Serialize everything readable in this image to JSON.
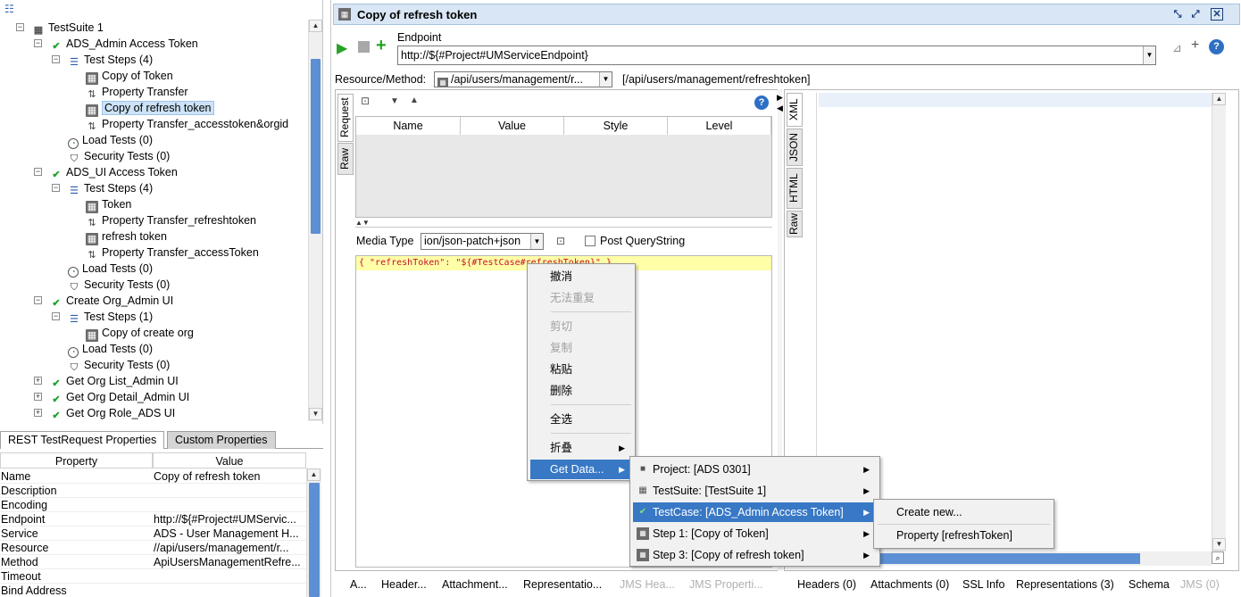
{
  "tree": {
    "rows": [
      {
        "label": "TestSuite 1"
      },
      {
        "label": "ADS_Admin Access Token"
      },
      {
        "label": "Test Steps (4)"
      },
      {
        "label": "Copy of Token"
      },
      {
        "label": "Property Transfer"
      },
      {
        "label": "Copy of refresh token"
      },
      {
        "label": "Property Transfer_accesstoken&orgid"
      },
      {
        "label": "Load Tests (0)"
      },
      {
        "label": "Security Tests (0)"
      },
      {
        "label": "ADS_UI Access Token"
      },
      {
        "label": "Test Steps (4)"
      },
      {
        "label": "Token"
      },
      {
        "label": "Property Transfer_refreshtoken"
      },
      {
        "label": "refresh token"
      },
      {
        "label": "Property Transfer_accessToken"
      },
      {
        "label": "Load Tests (0)"
      },
      {
        "label": "Security Tests (0)"
      },
      {
        "label": "Create Org_Admin UI"
      },
      {
        "label": "Test Steps (1)"
      },
      {
        "label": "Copy of create org"
      },
      {
        "label": "Load Tests (0)"
      },
      {
        "label": "Security Tests (0)"
      },
      {
        "label": "Get Org List_Admin UI"
      },
      {
        "label": "Get Org Detail_Admin UI"
      },
      {
        "label": "Get Org Role_ADS UI"
      }
    ]
  },
  "props": {
    "tabs": [
      "REST TestRequest Properties",
      "Custom Properties"
    ],
    "headers": {
      "property": "Property",
      "value": "Value"
    },
    "rows": [
      {
        "k": "Name",
        "v": "Copy of refresh token"
      },
      {
        "k": "Description",
        "v": ""
      },
      {
        "k": "Encoding",
        "v": ""
      },
      {
        "k": "Endpoint",
        "v": "http://${#Project#UMServic..."
      },
      {
        "k": "Service",
        "v": "ADS - User Management H..."
      },
      {
        "k": "Resource",
        "v": "//api/users/management/r..."
      },
      {
        "k": "Method",
        "v": "ApiUsersManagementRefre..."
      },
      {
        "k": "Timeout",
        "v": ""
      },
      {
        "k": "Bind Address",
        "v": ""
      }
    ]
  },
  "editor": {
    "title": "Copy of refresh token",
    "endpoint_label": "Endpoint",
    "endpoint_value": "http://${#Project#UMServiceEndpoint}",
    "resource_label": "Resource/Method:",
    "resource_value": "/api/users/management/r...",
    "resource_full": "[/api/users/management/refreshtoken]",
    "request_tab": "Request",
    "raw_tab": "Raw",
    "param_columns": [
      "Name",
      "Value",
      "Style",
      "Level"
    ],
    "media_type_label": "Media Type",
    "media_type_value": "ion/json-patch+json",
    "post_querystring": "Post QueryString",
    "body_text": "{   \"refreshToken\": \"${#TestCase#refreshToken}\" }",
    "response_tabs": [
      "XML",
      "JSON",
      "HTML",
      "Raw"
    ],
    "bottom_tabs_left": [
      {
        "label": "A...",
        "disabled": false
      },
      {
        "label": "Header...",
        "disabled": false
      },
      {
        "label": "Attachment...",
        "disabled": false
      },
      {
        "label": "Representatio...",
        "disabled": false
      },
      {
        "label": "JMS Hea...",
        "disabled": true
      },
      {
        "label": "JMS Properti...",
        "disabled": true
      }
    ],
    "bottom_tabs_right": [
      {
        "label": "Headers (0)",
        "disabled": false
      },
      {
        "label": "Attachments (0)",
        "disabled": false
      },
      {
        "label": "SSL Info",
        "disabled": false
      },
      {
        "label": "Representations (3)",
        "disabled": false
      },
      {
        "label": "Schema",
        "disabled": false
      },
      {
        "label": "JMS (0)",
        "disabled": true
      }
    ]
  },
  "context_menu": {
    "items": [
      "撤消",
      "无法重复",
      "剪切",
      "复制",
      "粘贴",
      "删除",
      "全选",
      "折叠",
      "Get Data..."
    ]
  },
  "submenu_getdata": {
    "items": [
      {
        "label": "Project: [ADS 0301]",
        "icon": "folder-icon"
      },
      {
        "label": "TestSuite: [TestSuite 1]",
        "icon": "grid-icon"
      },
      {
        "label": "TestCase: [ADS_Admin Access Token]",
        "icon": "check-icon"
      },
      {
        "label": "Step 1: [Copy of Token]",
        "icon": "step-icon"
      },
      {
        "label": "Step 3: [Copy of refresh token]",
        "icon": "step-icon"
      }
    ]
  },
  "submenu_testcase": {
    "items": [
      "Create new...",
      "Property [refreshToken]"
    ]
  },
  "colors": {
    "accent": "#3878c5",
    "title_bg": "#d9e6f5",
    "check": "#1fa32a",
    "body_highlight": "#ffffa8"
  }
}
